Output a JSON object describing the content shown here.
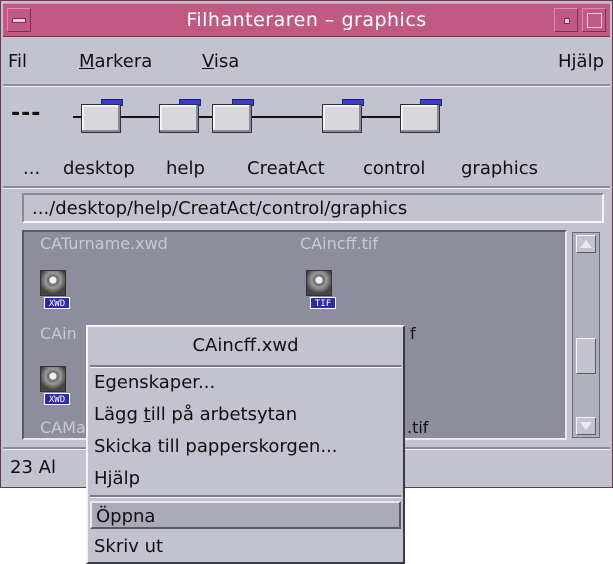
{
  "window": {
    "title": "Filhanteraren – graphics"
  },
  "menubar": {
    "file": "Fil",
    "select_prefix": "",
    "select_u": "M",
    "select_rest": "arkera",
    "view_u": "V",
    "view_rest": "isa",
    "help": "Hjälp"
  },
  "path": {
    "leading": "---",
    "items": [
      "...",
      "desktop",
      "help",
      "CreatAct",
      "control",
      "graphics"
    ],
    "location": ".../desktop/help/CreatAct/control/graphics"
  },
  "files": {
    "top_left_name": "CATurname.xwd",
    "top_right_name": "CAincff.tif",
    "icon1_badge": "XWD",
    "icon1_name": "CAin",
    "icon2_badge": "TIF",
    "icon2_name_tail": "f",
    "icon3_badge": "XWD",
    "icon3_name": "CAMa",
    "icon4_name_tail": ".tif"
  },
  "status": {
    "text": "23 Al"
  },
  "context_menu": {
    "title": "CAincff.xwd",
    "items": {
      "properties": "Egenskaper...",
      "add_desktop_pre": "Lägg ",
      "add_desktop_u": "t",
      "add_desktop_post": "ill på arbetsytan",
      "trash": "Skicka till papperskorgen...",
      "help": "Hjälp",
      "open": "Öppna",
      "print": "Skriv ut"
    }
  },
  "colors": {
    "titlebar": "#c15a82",
    "window_bg": "#c3c3cf",
    "file_area_bg": "#8d8d9d",
    "badge": "#2b2ba6"
  }
}
